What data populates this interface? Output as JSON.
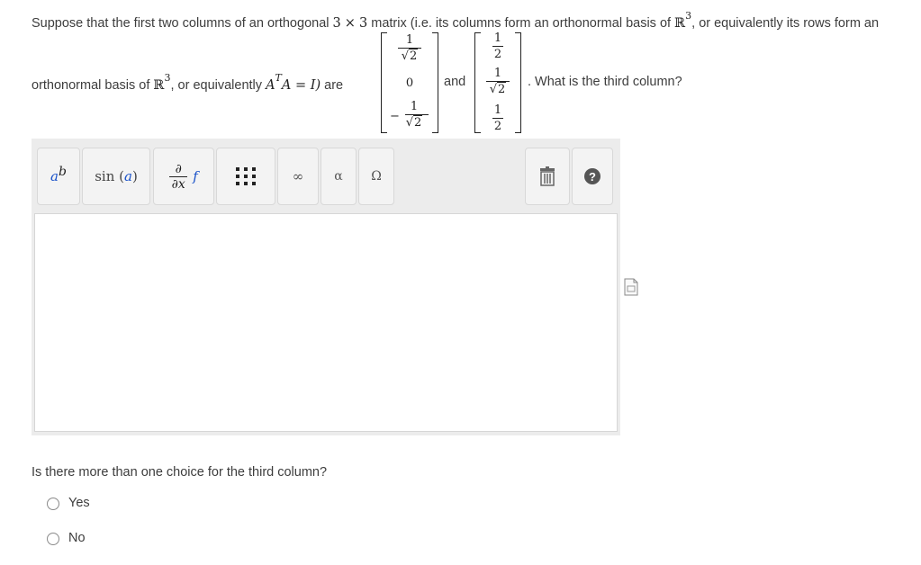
{
  "question": {
    "line1_prefix": "Suppose that the first two columns of an orthogonal",
    "line1_dim_a": "3",
    "line1_times": "×",
    "line1_dim_b": "3",
    "line1_mid": "matrix (i.e. its columns form an orthonormal basis of",
    "reals": "ℝ",
    "exp3": "3",
    "line1_suffix": ", or equivalently its rows form an",
    "line2_prefix": "orthonormal basis of",
    "line2_mid": ", or equivalently",
    "eq_A": "A",
    "eq_T": "T",
    "eq_rest": "A = I)",
    "line2_are": "are",
    "and_word": "and",
    "line2_suffix": ". What is the third column?",
    "col1": {
      "r1_num": "1",
      "r1_den": "2",
      "r2": "0",
      "r3_sign": "−",
      "r3_num": "1",
      "r3_den": "2"
    },
    "col2": {
      "r1_num": "1",
      "r1_den": "2",
      "r2_num": "1",
      "r2_den": "2",
      "r3_num": "1",
      "r3_den": "2"
    },
    "sqrt_symbol": "√"
  },
  "toolbar": {
    "power_base": "a",
    "power_exp": "b",
    "sin_label": "sin",
    "sin_arg": "a",
    "partial_num": "∂",
    "partial_den": "∂x",
    "partial_f": "f",
    "infinity": "∞",
    "alpha": "α",
    "omega": "Ω",
    "help": "?"
  },
  "followup": {
    "question": "Is there more than one choice for the third column?",
    "options": [
      "Yes",
      "No"
    ]
  }
}
